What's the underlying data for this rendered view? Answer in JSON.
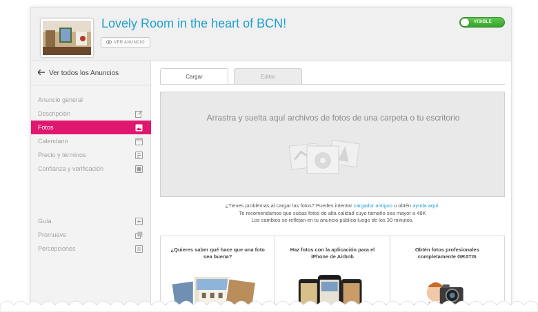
{
  "header": {
    "listing_title": "Lovely Room in the heart of BCN!",
    "view_listing_label": "VER ANUNCIO",
    "visibility_label": "VISIBLE"
  },
  "sidebar": {
    "back_label": "Ver todos los Anuncios",
    "items": [
      {
        "label": "Anuncio general",
        "icon": ""
      },
      {
        "label": "Descripción",
        "icon": "edit-icon"
      },
      {
        "label": "Fotos",
        "icon": "photo-icon",
        "active": true
      },
      {
        "label": "Calendario",
        "icon": "calendar-icon"
      },
      {
        "label": "Precio y términos",
        "icon": "price-icon"
      },
      {
        "label": "Confianza y verificación",
        "icon": "verification-icon"
      }
    ],
    "secondary_items": [
      {
        "label": "Guía",
        "icon": "guide-icon"
      },
      {
        "label": "Promueve",
        "icon": "promote-icon"
      },
      {
        "label": "Percepciones",
        "icon": "insights-icon"
      }
    ]
  },
  "tabs": [
    {
      "label": "Cargar",
      "active": true
    },
    {
      "label": "Editar",
      "active": false
    }
  ],
  "dropzone": {
    "text": "Arrastra y suelta aquí archivos de fotos de una carpeta o tu escritorio"
  },
  "help": {
    "line1_prefix": "¿Tienes problemas al cargar las fotos? Puedes intentar ",
    "old_uploader_link": "cargador antiguo",
    "line1_middle": " u obtén ",
    "help_link": "ayuda aquí",
    "line1_suffix": ".",
    "line2": "Te recomendamos que subas fotos de alta calidad cuyo tamaño sea mayor a 48K",
    "line3": "Los cambios se reflejan en tu anuncio público luego de los 30 minutos."
  },
  "cards": [
    {
      "title": "¿Quieres saber qué hace que una foto sea buena?"
    },
    {
      "title": "Haz fotos con la aplicación para el iPhone de Airbnb"
    },
    {
      "title": "Obtén fotos profesionales completamente GRATIS"
    }
  ],
  "colors": {
    "accent_pink": "#e0176f",
    "link_blue": "#1e9fcf",
    "visible_green": "#43b236"
  }
}
